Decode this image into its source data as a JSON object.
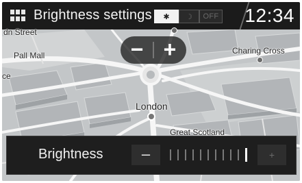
{
  "header": {
    "title": "Brightness settings",
    "menu_icon": "grid-menu-icon",
    "modes": {
      "day_icon": "✱",
      "night_icon": "☽",
      "off_label": "OFF"
    },
    "clock": "12:34"
  },
  "map": {
    "zoom_out_label": "−",
    "zoom_in_label": "+",
    "labels": {
      "fragment_top": "dn Street",
      "pall_mall": "Pall Mall",
      "charing_cross": "Charing Cross",
      "fragment_left": "ce",
      "london": "London",
      "great_scotland": "Great Scotland"
    }
  },
  "brightness": {
    "label": "Brightness",
    "minus_label": "–",
    "plus_label": "+",
    "level": 11,
    "max_level": 11
  },
  "colors": {
    "header_bg": "#1b1b1b",
    "panel_bg": "#1e1e1e",
    "map_bg": "#c4c7c9",
    "road": "#f5f5f5"
  }
}
